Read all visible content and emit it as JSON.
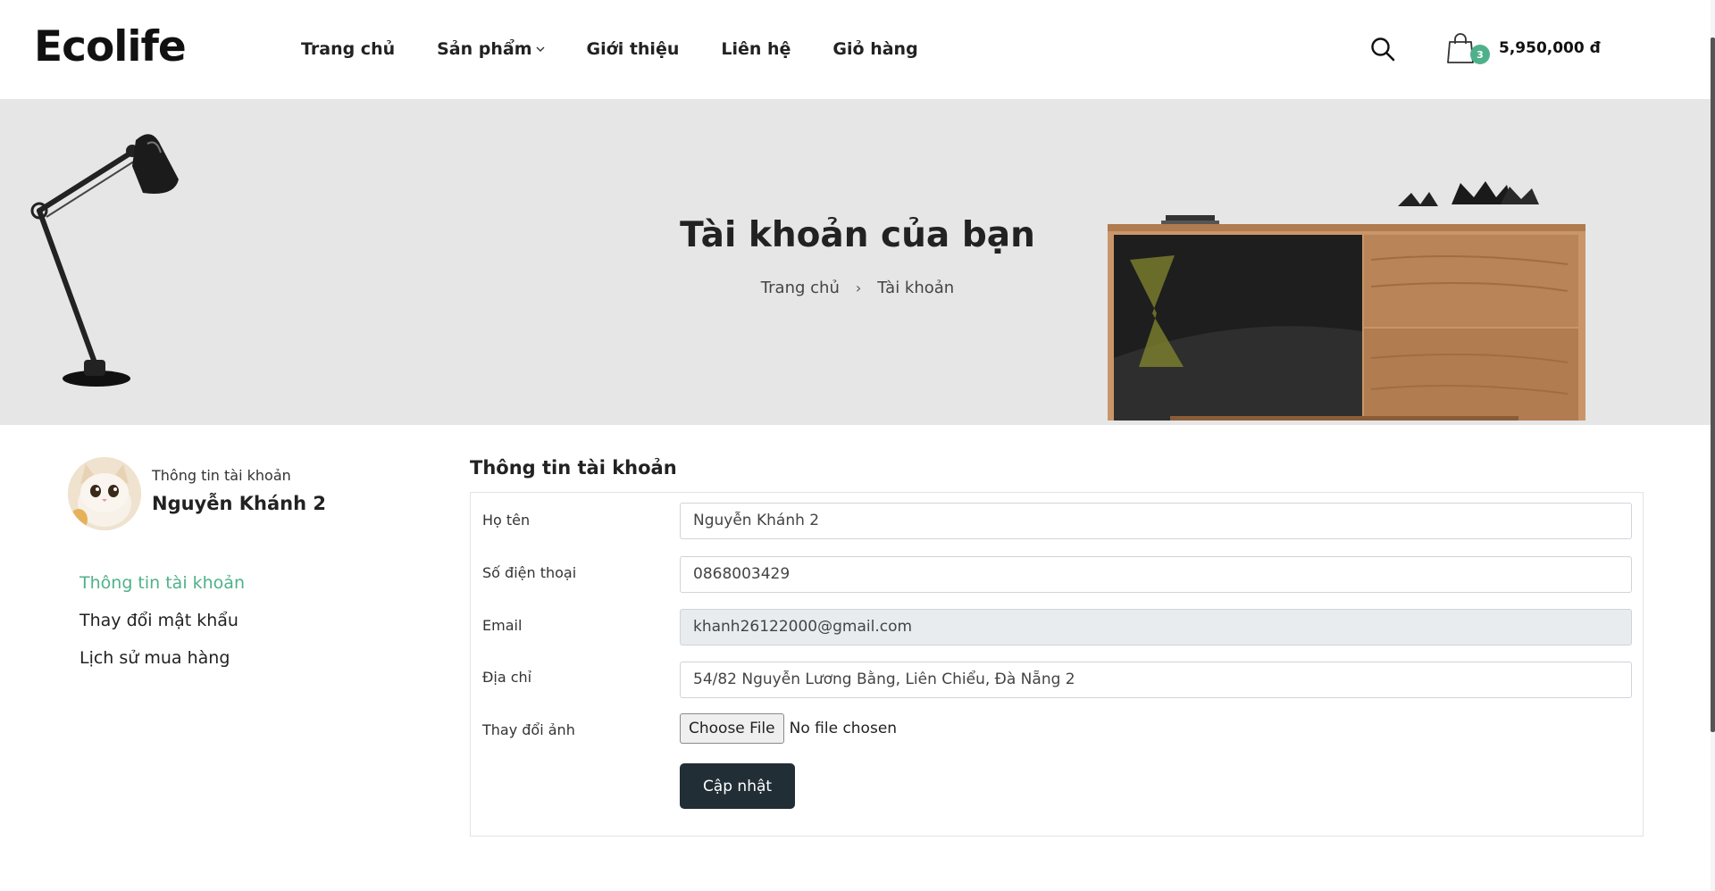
{
  "header": {
    "logo": "Ecolife",
    "nav": [
      {
        "label": "Trang chủ"
      },
      {
        "label": "Sản phẩm"
      },
      {
        "label": "Giới thiệu"
      },
      {
        "label": "Liên hệ"
      },
      {
        "label": "Giỏ hàng"
      }
    ],
    "cart": {
      "count": "3",
      "total": "5,950,000 đ"
    }
  },
  "banner": {
    "title": "Tài khoản của bạn",
    "breadcrumb": [
      {
        "label": "Trang chủ"
      },
      {
        "label": "Tài khoản"
      }
    ]
  },
  "sidebar": {
    "subtitle": "Thông tin tài khoản",
    "name": "Nguyễn Khánh 2",
    "menu": [
      {
        "label": "Thông tin tài khoản",
        "active": true
      },
      {
        "label": "Thay đổi mật khẩu"
      },
      {
        "label": "Lịch sử mua hàng"
      }
    ]
  },
  "form": {
    "title": "Thông tin tài khoản",
    "fields": [
      {
        "label": "Họ tên",
        "value": "Nguyễn Khánh 2"
      },
      {
        "label": "Số điện thoại",
        "value": "0868003429"
      },
      {
        "label": "Email",
        "value": "khanh26122000@gmail.com"
      },
      {
        "label": "Địa chỉ",
        "value": "54/82 Nguyễn Lương Bằng, Liên Chiểu, Đà Nẵng 2"
      }
    ],
    "photo": {
      "label": "Thay đổi ảnh",
      "button": "Choose File",
      "status": "No file chosen"
    },
    "submit": "Cập nhật"
  },
  "colors": {
    "accent": "#4fb18b",
    "button_dark": "#222e35",
    "banner_bg": "#e6e6e6"
  }
}
